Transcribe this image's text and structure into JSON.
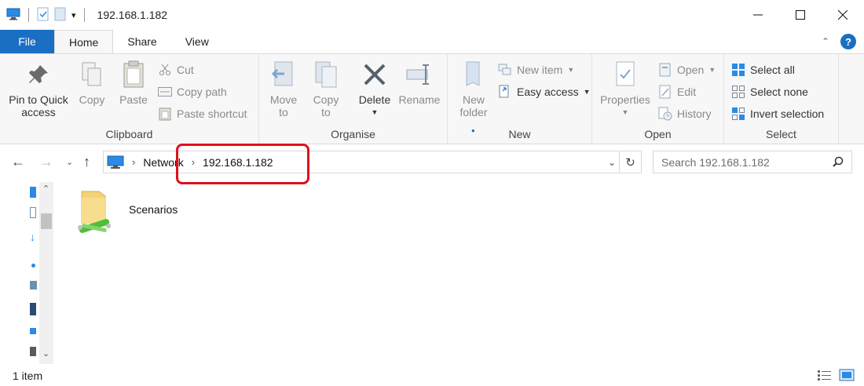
{
  "window": {
    "title": "192.168.1.182"
  },
  "tabs": {
    "file": "File",
    "home": "Home",
    "share": "Share",
    "view": "View"
  },
  "ribbon": {
    "clipboard": {
      "label": "Clipboard",
      "pin": [
        "Pin to Quick",
        "access"
      ],
      "copy": "Copy",
      "paste": "Paste",
      "cut": "Cut",
      "copy_path": "Copy path",
      "paste_shortcut": "Paste shortcut"
    },
    "organise": {
      "label": "Organise",
      "move_to": [
        "Move",
        "to"
      ],
      "copy_to": [
        "Copy",
        "to"
      ],
      "delete": "Delete",
      "rename": "Rename"
    },
    "new": {
      "label": "New",
      "new_folder": [
        "New",
        "folder"
      ],
      "new_item": "New item",
      "easy_access": "Easy access"
    },
    "open": {
      "label": "Open",
      "properties": "Properties",
      "open": "Open",
      "edit": "Edit",
      "history": "History"
    },
    "select": {
      "label": "Select",
      "select_all": "Select all",
      "select_none": "Select none",
      "invert_selection": "Invert selection"
    }
  },
  "address": {
    "crumbs": [
      "Network",
      "192.168.1.182"
    ],
    "search_placeholder": "Search 192.168.1.182"
  },
  "content": {
    "items": [
      {
        "label": "Scenarios"
      }
    ]
  },
  "status": {
    "count": "1 item"
  },
  "colors": {
    "accent": "#1a6fc4",
    "highlight": "#e0101a"
  }
}
